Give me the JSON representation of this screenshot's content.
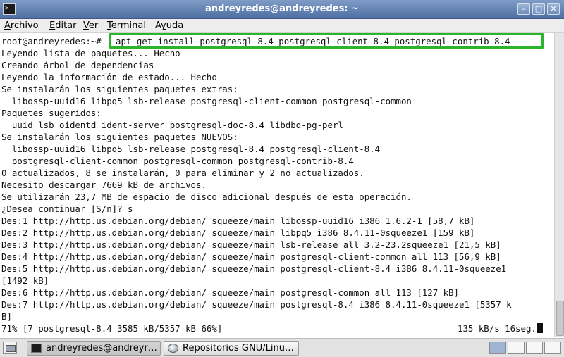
{
  "window": {
    "title": "andreyredes@andreyredes: ~",
    "icon": "terminal-icon",
    "buttons": {
      "minimize": "–",
      "maximize": "□",
      "close": "✕"
    }
  },
  "menu": [
    {
      "label": "Archivo",
      "mnemonic": "A",
      "rest": "rchivo"
    },
    {
      "label": "Editar",
      "mnemonic": "E",
      "rest": "ditar"
    },
    {
      "label": "Ver",
      "mnemonic": "V",
      "rest": "er"
    },
    {
      "label": "Terminal",
      "mnemonic": "T",
      "rest": "erminal"
    },
    {
      "label": "Ayuda",
      "mnemonic": "y",
      "pre": "A",
      "rest": "uda"
    }
  ],
  "terminal": {
    "prompt": "root@andreyredes:~#",
    "command": "apt-get install postgresql-8.4 postgresql-client-8.4 postgresql-contrib-8.4",
    "highlight_color": "#2bb52b",
    "lines": [
      "Leyendo lista de paquetes... Hecho",
      "Creando árbol de dependencias",
      "Leyendo la información de estado... Hecho",
      "Se instalarán los siguientes paquetes extras:",
      "  libossp-uuid16 libpq5 lsb-release postgresql-client-common postgresql-common",
      "Paquetes sugeridos:",
      "  uuid lsb oidentd ident-server postgresql-doc-8.4 libdbd-pg-perl",
      "Se instalarán los siguientes paquetes NUEVOS:",
      "  libossp-uuid16 libpq5 lsb-release postgresql-8.4 postgresql-client-8.4",
      "  postgresql-client-common postgresql-common postgresql-contrib-8.4",
      "0 actualizados, 8 se instalarán, 0 para eliminar y 2 no actualizados.",
      "Necesito descargar 7669 kB de archivos.",
      "Se utilizarán 23,7 MB de espacio de disco adicional después de esta operación.",
      "¿Desea continuar [S/n]? s",
      "Des:1 http://http.us.debian.org/debian/ squeeze/main libossp-uuid16 i386 1.6.2-1 [58,7 kB]",
      "Des:2 http://http.us.debian.org/debian/ squeeze/main libpq5 i386 8.4.11-0squeeze1 [159 kB]",
      "Des:3 http://http.us.debian.org/debian/ squeeze/main lsb-release all 3.2-23.2squeeze1 [21,5 kB]",
      "Des:4 http://http.us.debian.org/debian/ squeeze/main postgresql-client-common all 113 [56,9 kB]",
      "Des:5 http://http.us.debian.org/debian/ squeeze/main postgresql-client-8.4 i386 8.4.11-0squeeze1",
      "[1492 kB]",
      "Des:6 http://http.us.debian.org/debian/ squeeze/main postgresql-common all 113 [127 kB]",
      "Des:7 http://http.us.debian.org/debian/ squeeze/main postgresql-8.4 i386 8.4.11-0squeeze1 [5357 k",
      "B]"
    ],
    "progress_left": "71% [7 postgresql-8.4 3585 kB/5357 kB 66%]",
    "progress_right": "135 kB/s 16seg."
  },
  "taskbar": {
    "show_desktop_icon": "show-desktop-icon",
    "tasks": [
      {
        "label": "andreyredes@andreyr…",
        "icon": "terminal-icon",
        "active": true
      },
      {
        "label": "Repositorios GNU/Linu…",
        "icon": "browser-icon",
        "active": false
      }
    ],
    "workspaces": 4
  }
}
